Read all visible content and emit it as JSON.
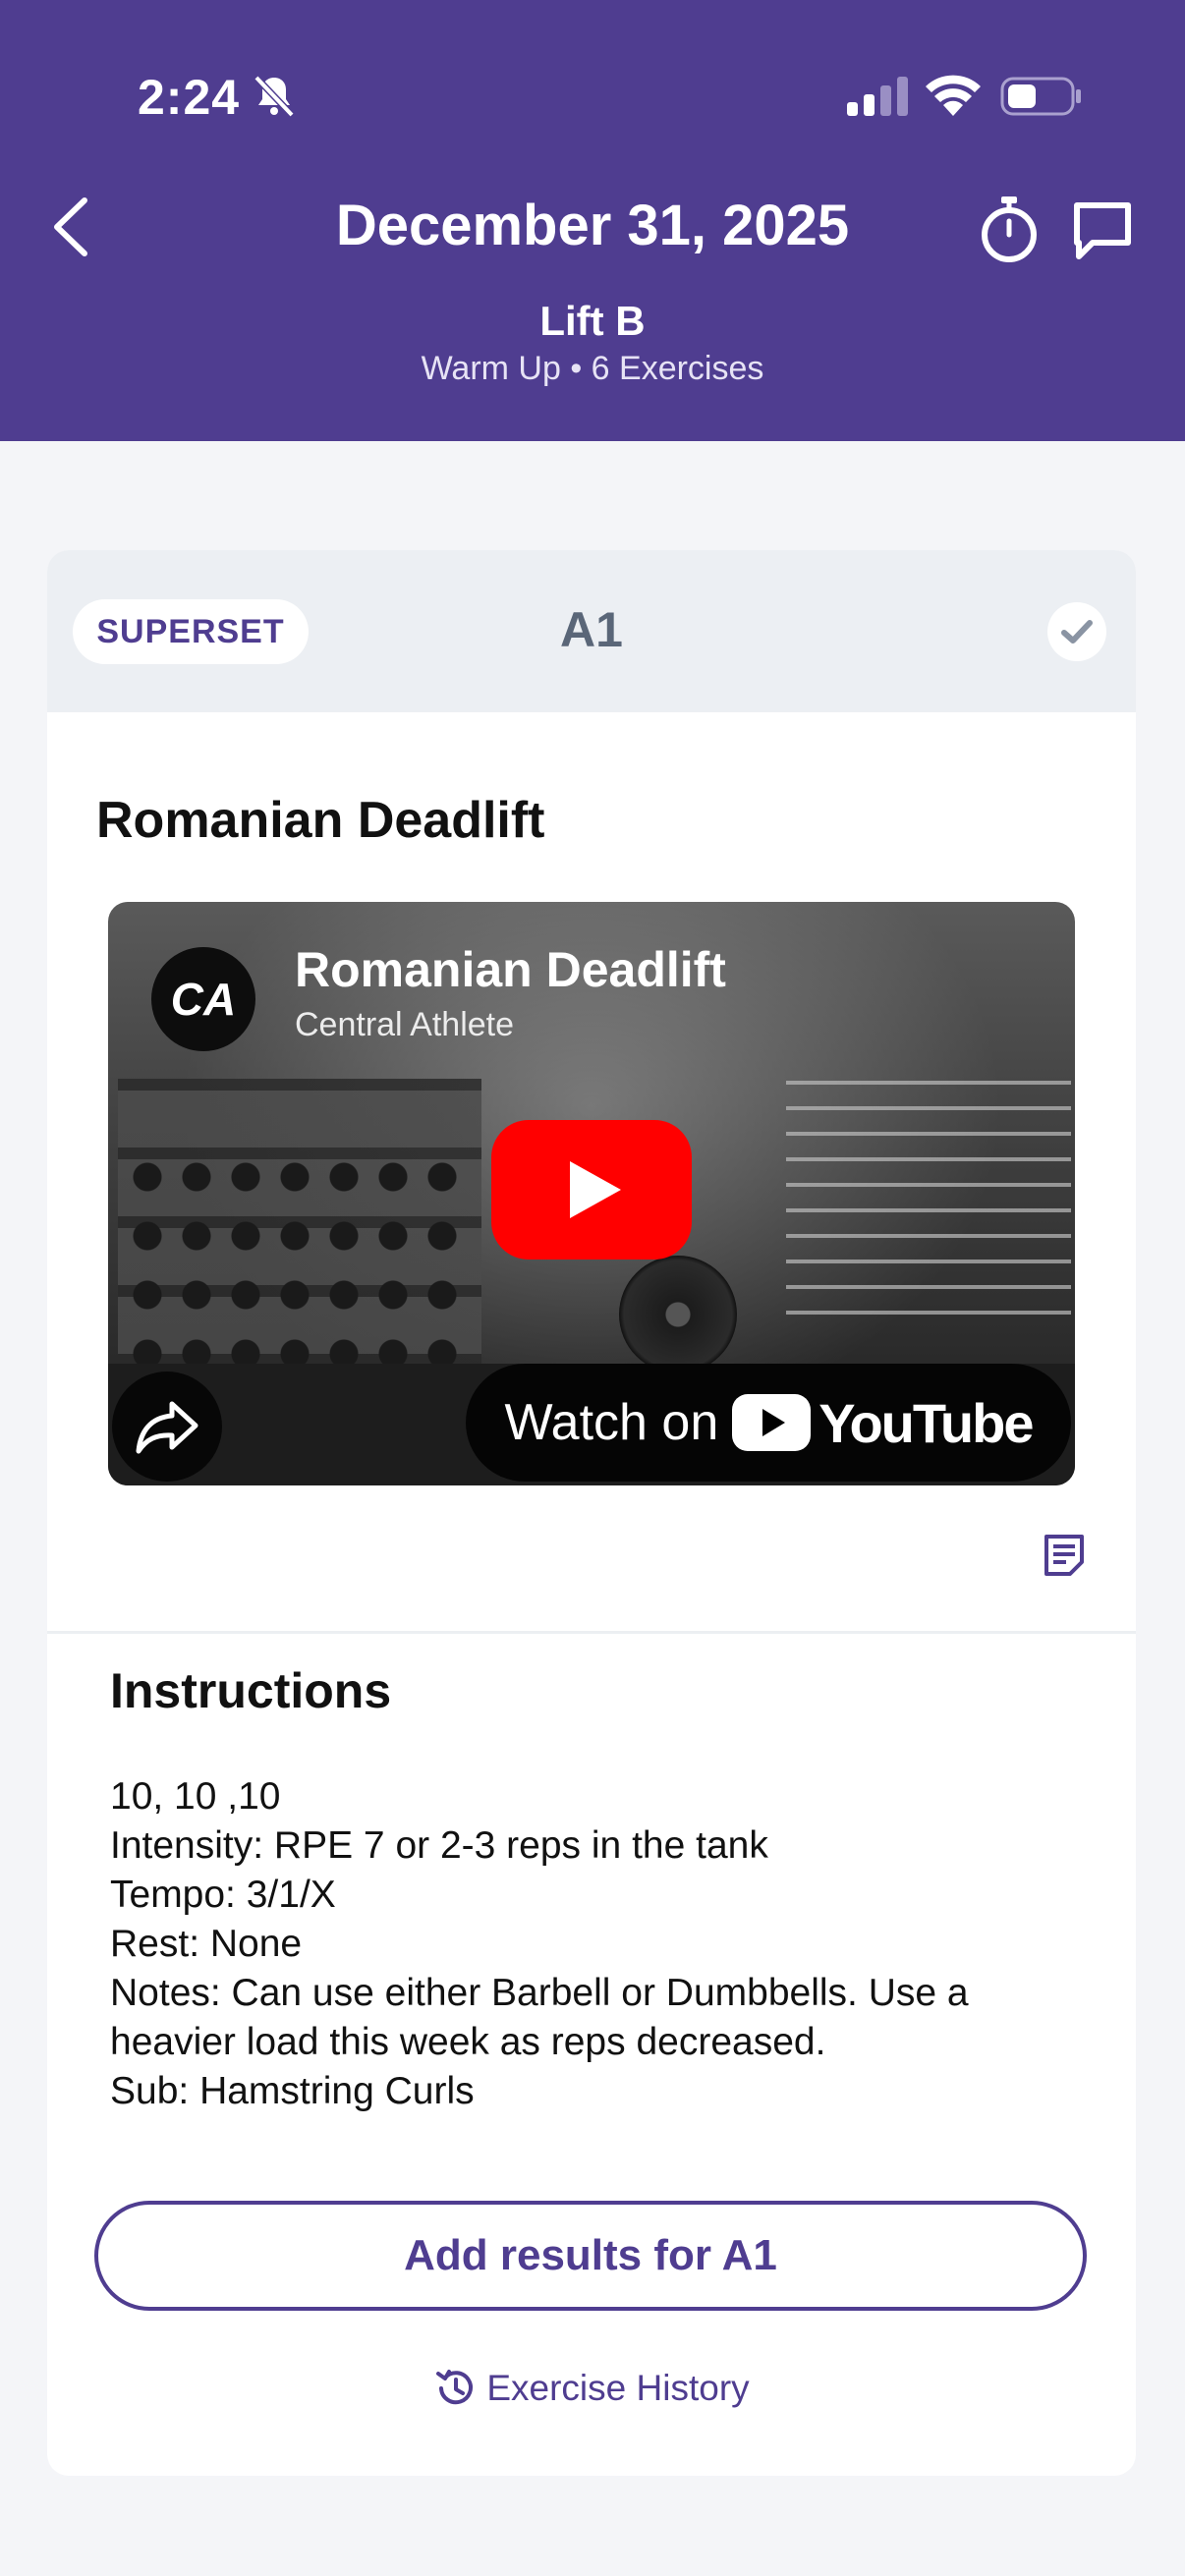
{
  "status_bar": {
    "time": "2:24"
  },
  "header": {
    "date": "December 31, 2025",
    "workout_title": "Lift B",
    "workout_subtitle": "Warm Up • 6 Exercises"
  },
  "card": {
    "badge": "SUPERSET",
    "label": "A1",
    "exercise_name": "Romanian Deadlift",
    "video": {
      "channel_logo": "CA",
      "title": "Romanian Deadlift",
      "channel": "Central Athlete",
      "watch_on": "Watch on",
      "youtube": "YouTube"
    },
    "instructions": {
      "title": "Instructions",
      "lines": [
        "10, 10 ,10",
        "Intensity: RPE 7 or 2-3 reps in the tank",
        "Tempo: 3/1/X",
        "Rest: None",
        "Notes: Can use either Barbell or Dumbbells. Use a",
        "heavier load this week as reps decreased.",
        "Sub: Hamstring Curls"
      ]
    },
    "add_results_label": "Add results for A1",
    "history_label": "Exercise History"
  },
  "colors": {
    "brand": "#4f3d90",
    "youtube_red": "#ff0000"
  }
}
